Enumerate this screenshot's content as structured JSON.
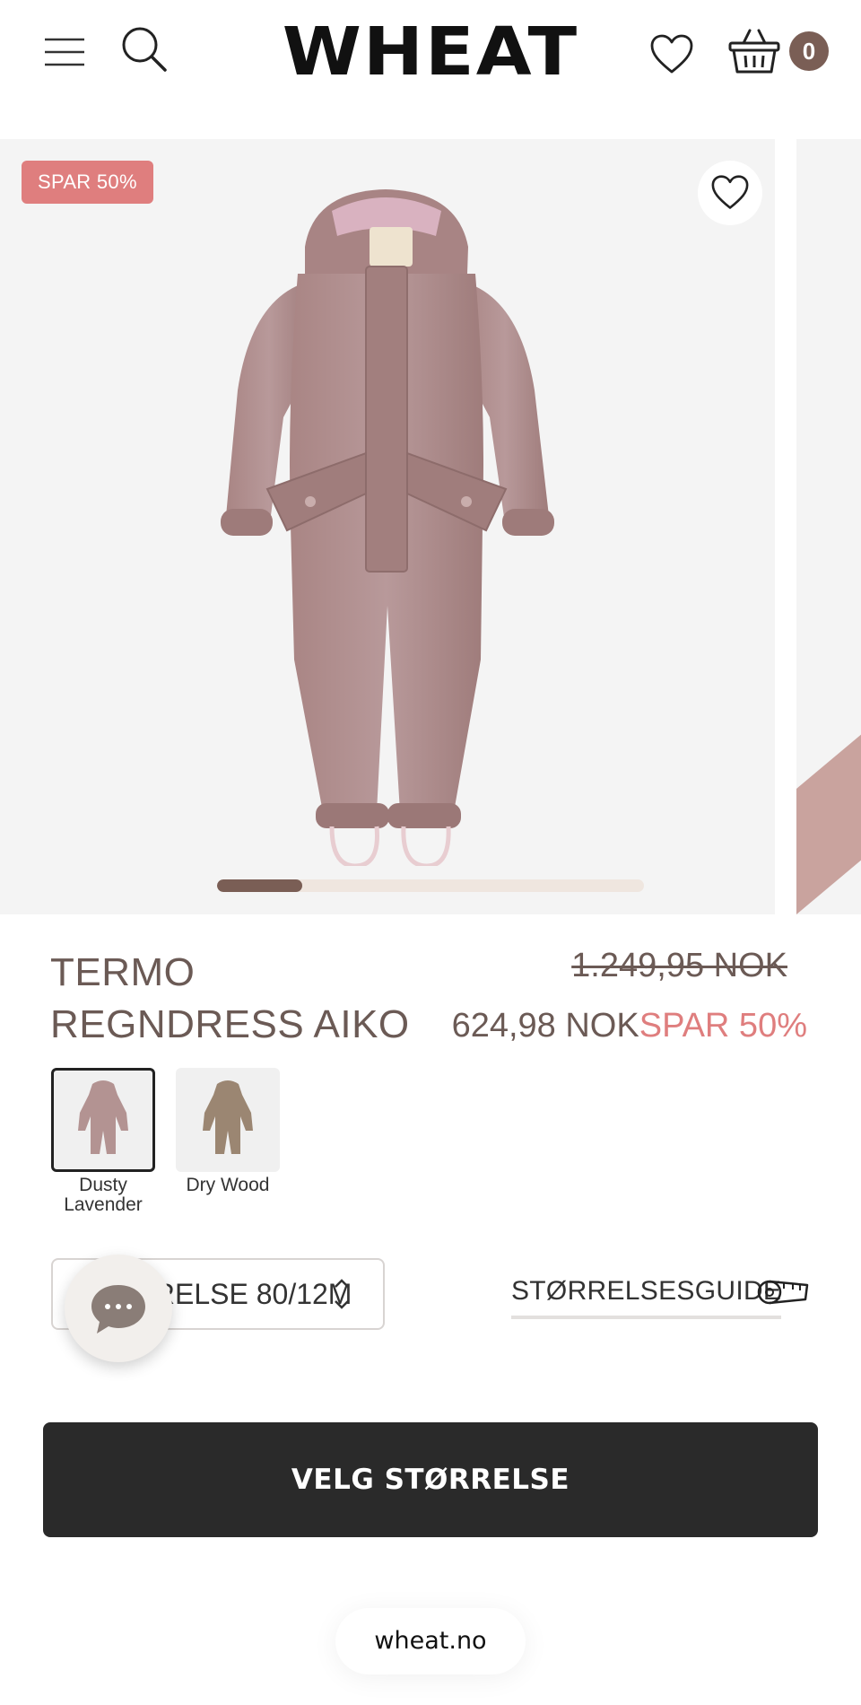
{
  "header": {
    "logo": "WHEAT",
    "cart_count": "0",
    "icons": [
      "menu-icon",
      "search-icon",
      "heart-icon",
      "basket-icon"
    ]
  },
  "gallery": {
    "sale_badge": "SPAR 50%",
    "image_progress": 0.2,
    "colors": {
      "badge": "#df7e7e",
      "progress": "#7a5e55",
      "track": "#efe6df"
    }
  },
  "product": {
    "title": "TERMO REGNDRESS AIKO",
    "price_old": "1.249,95 NOK",
    "price_now": "624,98 NOK",
    "price_save": "SPAR 50%",
    "variants": [
      {
        "label": "Dusty Lavender",
        "color": "#b39392",
        "selected": true
      },
      {
        "label": "Dry Wood",
        "color": "#9b8672",
        "selected": false
      }
    ]
  },
  "size": {
    "selected": "STØRRELSE 80/12M",
    "guide_label": "STØRRELSESGUIDE"
  },
  "cta": {
    "label": "VELG STØRRELSE"
  },
  "browser": {
    "domain": "wheat.no"
  }
}
